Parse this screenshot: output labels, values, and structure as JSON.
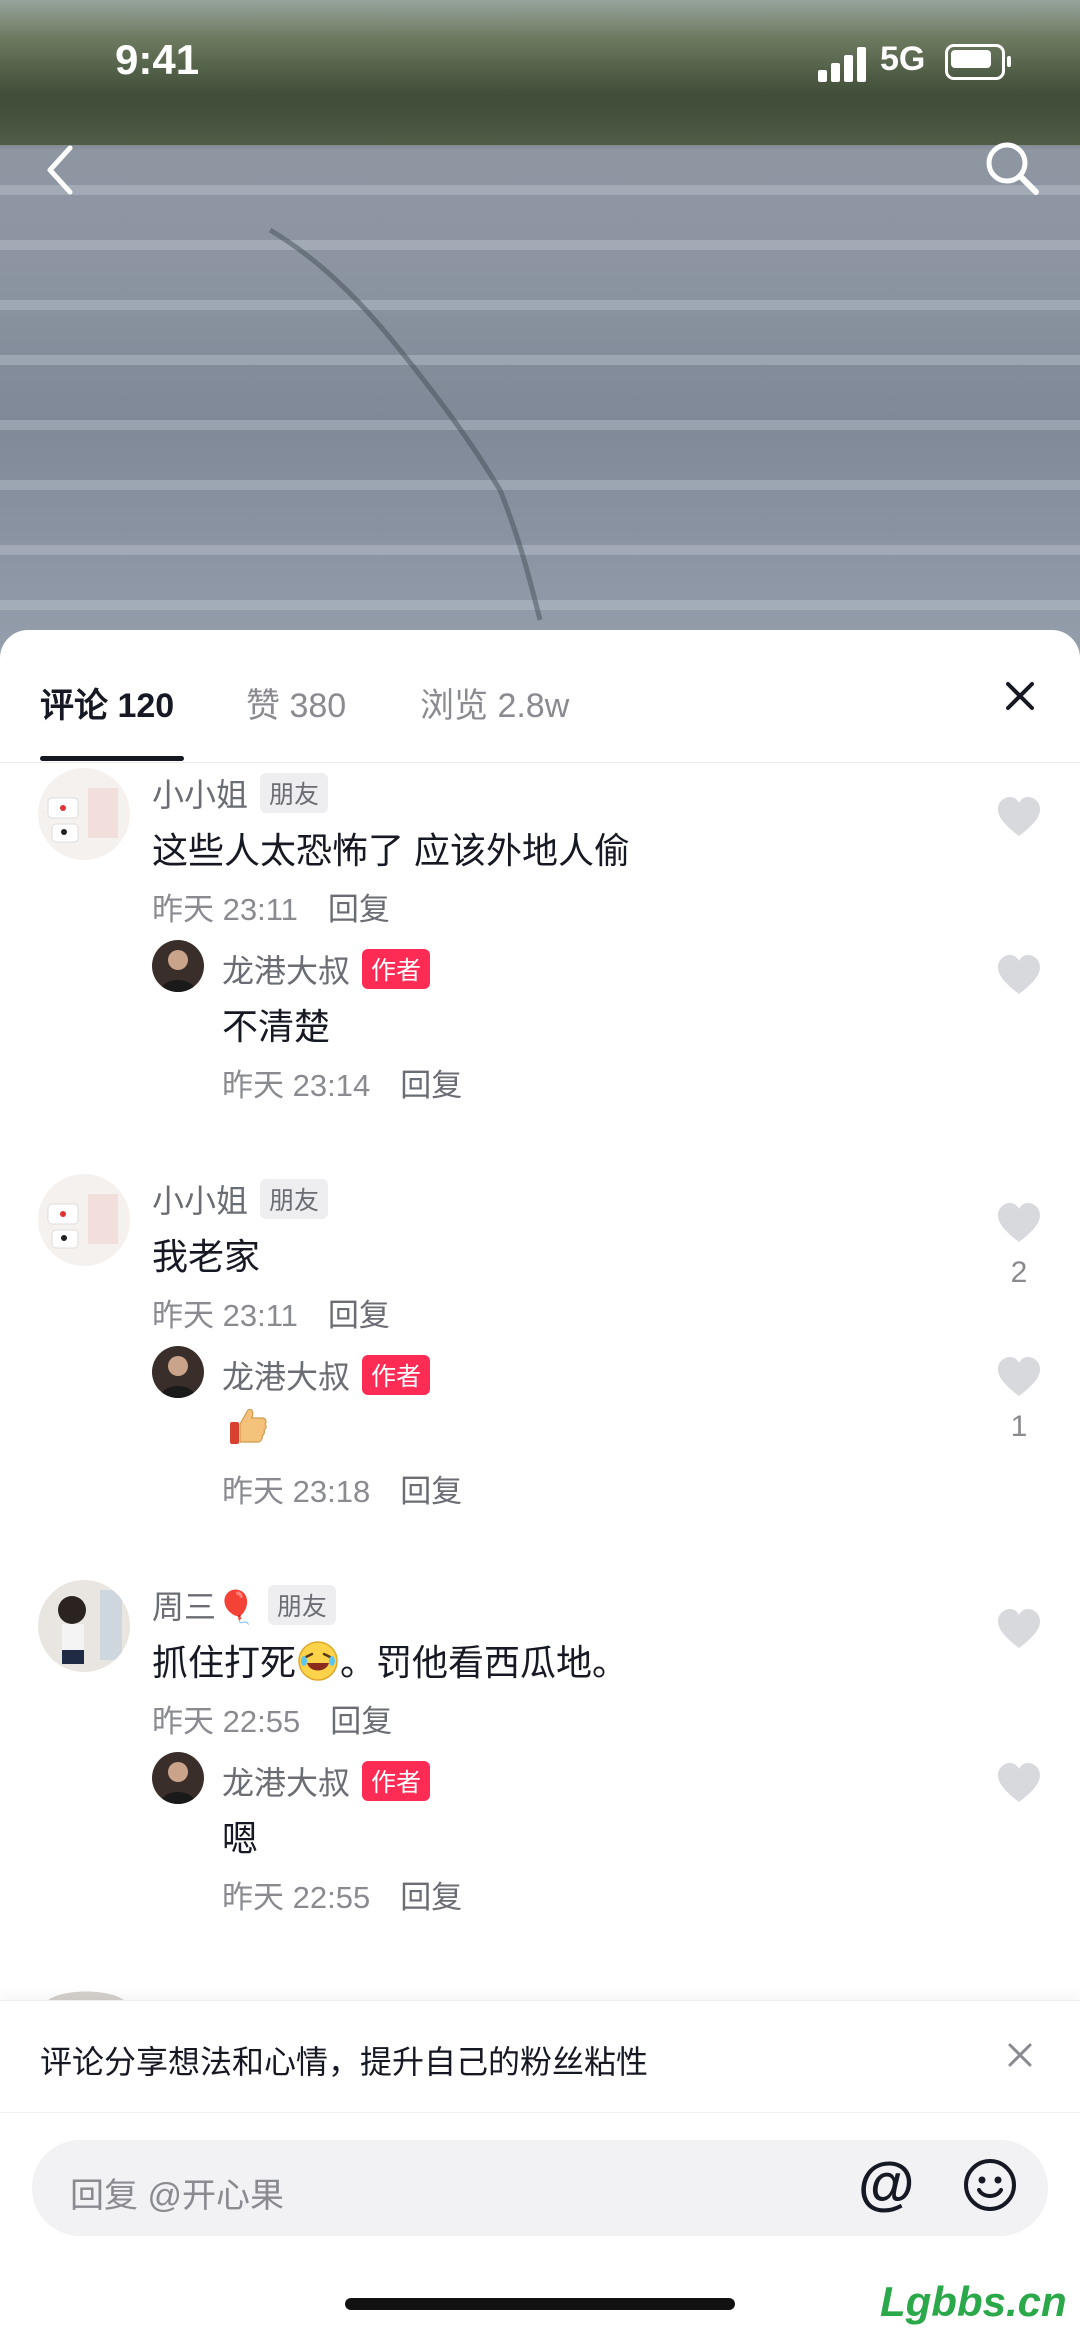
{
  "status": {
    "time": "9:41",
    "network": "5G"
  },
  "tabs": [
    {
      "label": "评论 120"
    },
    {
      "label": "赞 380"
    },
    {
      "label": "浏览 2.8w"
    }
  ],
  "comments": [
    {
      "name": "小小姐",
      "tag": "朋友",
      "text": "这些人太恐怖了 应该外地人偷",
      "time": "昨天 23:11",
      "reply": "回复",
      "likes": ""
    },
    {
      "name": "龙港大叔",
      "tag": "作者",
      "text": "不清楚",
      "time": "昨天 23:14",
      "reply": "回复",
      "likes": ""
    },
    {
      "name": "小小姐",
      "tag": "朋友",
      "text": "我老家",
      "time": "昨天 23:11",
      "reply": "回复",
      "likes": "2"
    },
    {
      "name": "龙港大叔",
      "tag": "作者",
      "text": "",
      "time": "昨天 23:18",
      "reply": "回复",
      "likes": "1"
    },
    {
      "name": "周三🎈",
      "tag": "朋友",
      "text_a": "抓住打死",
      "text_b": "。罚他看西瓜地。",
      "time": "昨天 22:55",
      "reply": "回复",
      "likes": ""
    },
    {
      "name": "龙港大叔",
      "tag": "作者",
      "text": "嗯",
      "time": "昨天 22:55",
      "reply": "回复",
      "likes": ""
    }
  ],
  "tip": {
    "text": "评论分享想法和心情，提升自己的粉丝粘性"
  },
  "input": {
    "placeholder": "回复 @开心果"
  },
  "icons": [
    "back-arrow-icon",
    "search-icon",
    "close-icon",
    "heart-icon",
    "thumbs-up-emoji-icon",
    "laughing-emoji-icon",
    "at-icon",
    "emoji-icon"
  ],
  "colors": {
    "author_tag": "#fe2c55",
    "text": "#161823",
    "secondary": "#8a8b91"
  },
  "watermark": "Lgbbs.cn"
}
